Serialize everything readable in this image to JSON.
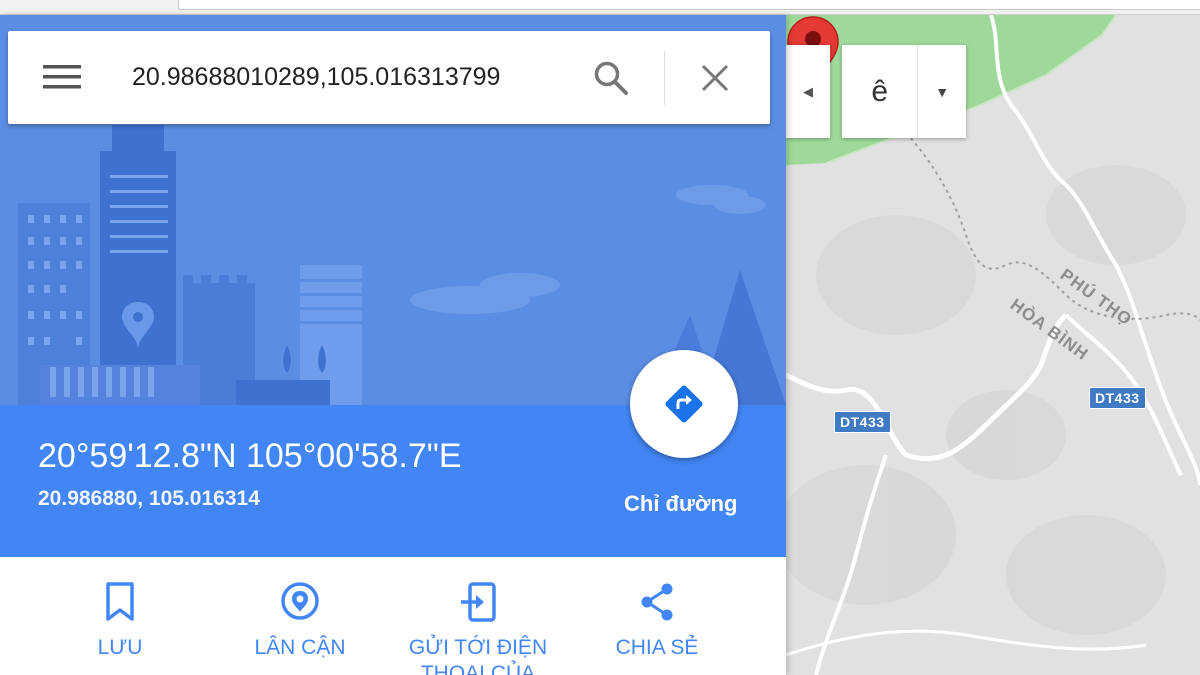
{
  "search": {
    "value": "20.98688010289,105.016313799",
    "menu_icon": "hamburger-menu-icon",
    "search_icon": "search-icon",
    "clear_icon": "close-icon"
  },
  "place": {
    "coord_dms": "20°59'12.8\"N 105°00'58.7\"E",
    "coord_decimal": "20.986880, 105.016314"
  },
  "directions": {
    "label": "Chỉ đường",
    "icon": "directions-arrow-icon"
  },
  "actions": [
    {
      "label": "LƯU",
      "icon": "bookmark-icon"
    },
    {
      "label": "LÂN CẬN",
      "icon": "nearby-pin-icon"
    },
    {
      "label": "GỬI TỚI ĐIỆN THOẠI CỦA",
      "icon": "send-to-phone-icon"
    },
    {
      "label": "CHIA SẺ",
      "icon": "share-icon"
    }
  ],
  "map": {
    "language_value": "ê",
    "labels": {
      "province_north": "PHÚ THỌ",
      "province_south": "HÒA BÌNH"
    },
    "road_badges": [
      "DT433",
      "DT433"
    ],
    "colors": {
      "accent": "#4285f4",
      "marker": "#e53935",
      "forest": "#9ed99a",
      "land": "#e2e2e2"
    }
  }
}
